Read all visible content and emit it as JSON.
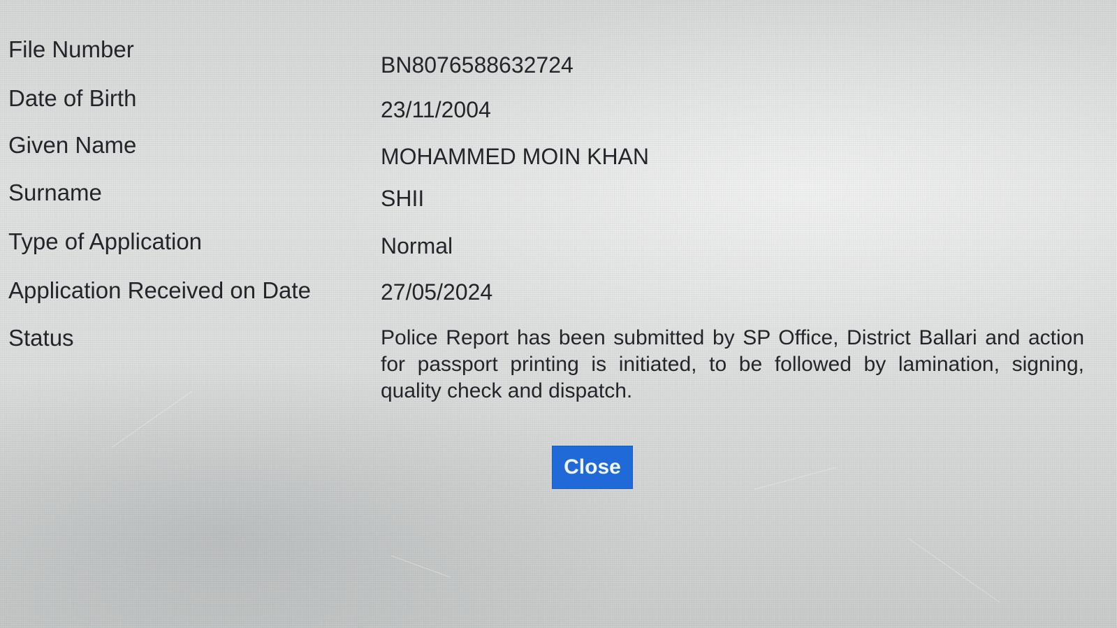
{
  "details": {
    "file_number": {
      "label": "File Number",
      "value": "BN8076588632724"
    },
    "date_of_birth": {
      "label": "Date of Birth",
      "value": "23/11/2004"
    },
    "given_name": {
      "label": "Given Name",
      "value": "MOHAMMED MOIN KHAN"
    },
    "surname": {
      "label": "Surname",
      "value": "SHII"
    },
    "type_of_application": {
      "label": "Type of Application",
      "value": "Normal"
    },
    "application_received": {
      "label": "Application Received on Date",
      "value": "27/05/2024"
    },
    "status": {
      "label": "Status",
      "value": "Police Report has been submitted by SP Office, District Ballari and action for passport printing is initiated, to be followed by lamination, signing, quality check and dispatch."
    }
  },
  "actions": {
    "close_label": "Close"
  },
  "colors": {
    "close_button": "#1f6ad8",
    "text": "#22262b",
    "background": "#dcdedd"
  }
}
